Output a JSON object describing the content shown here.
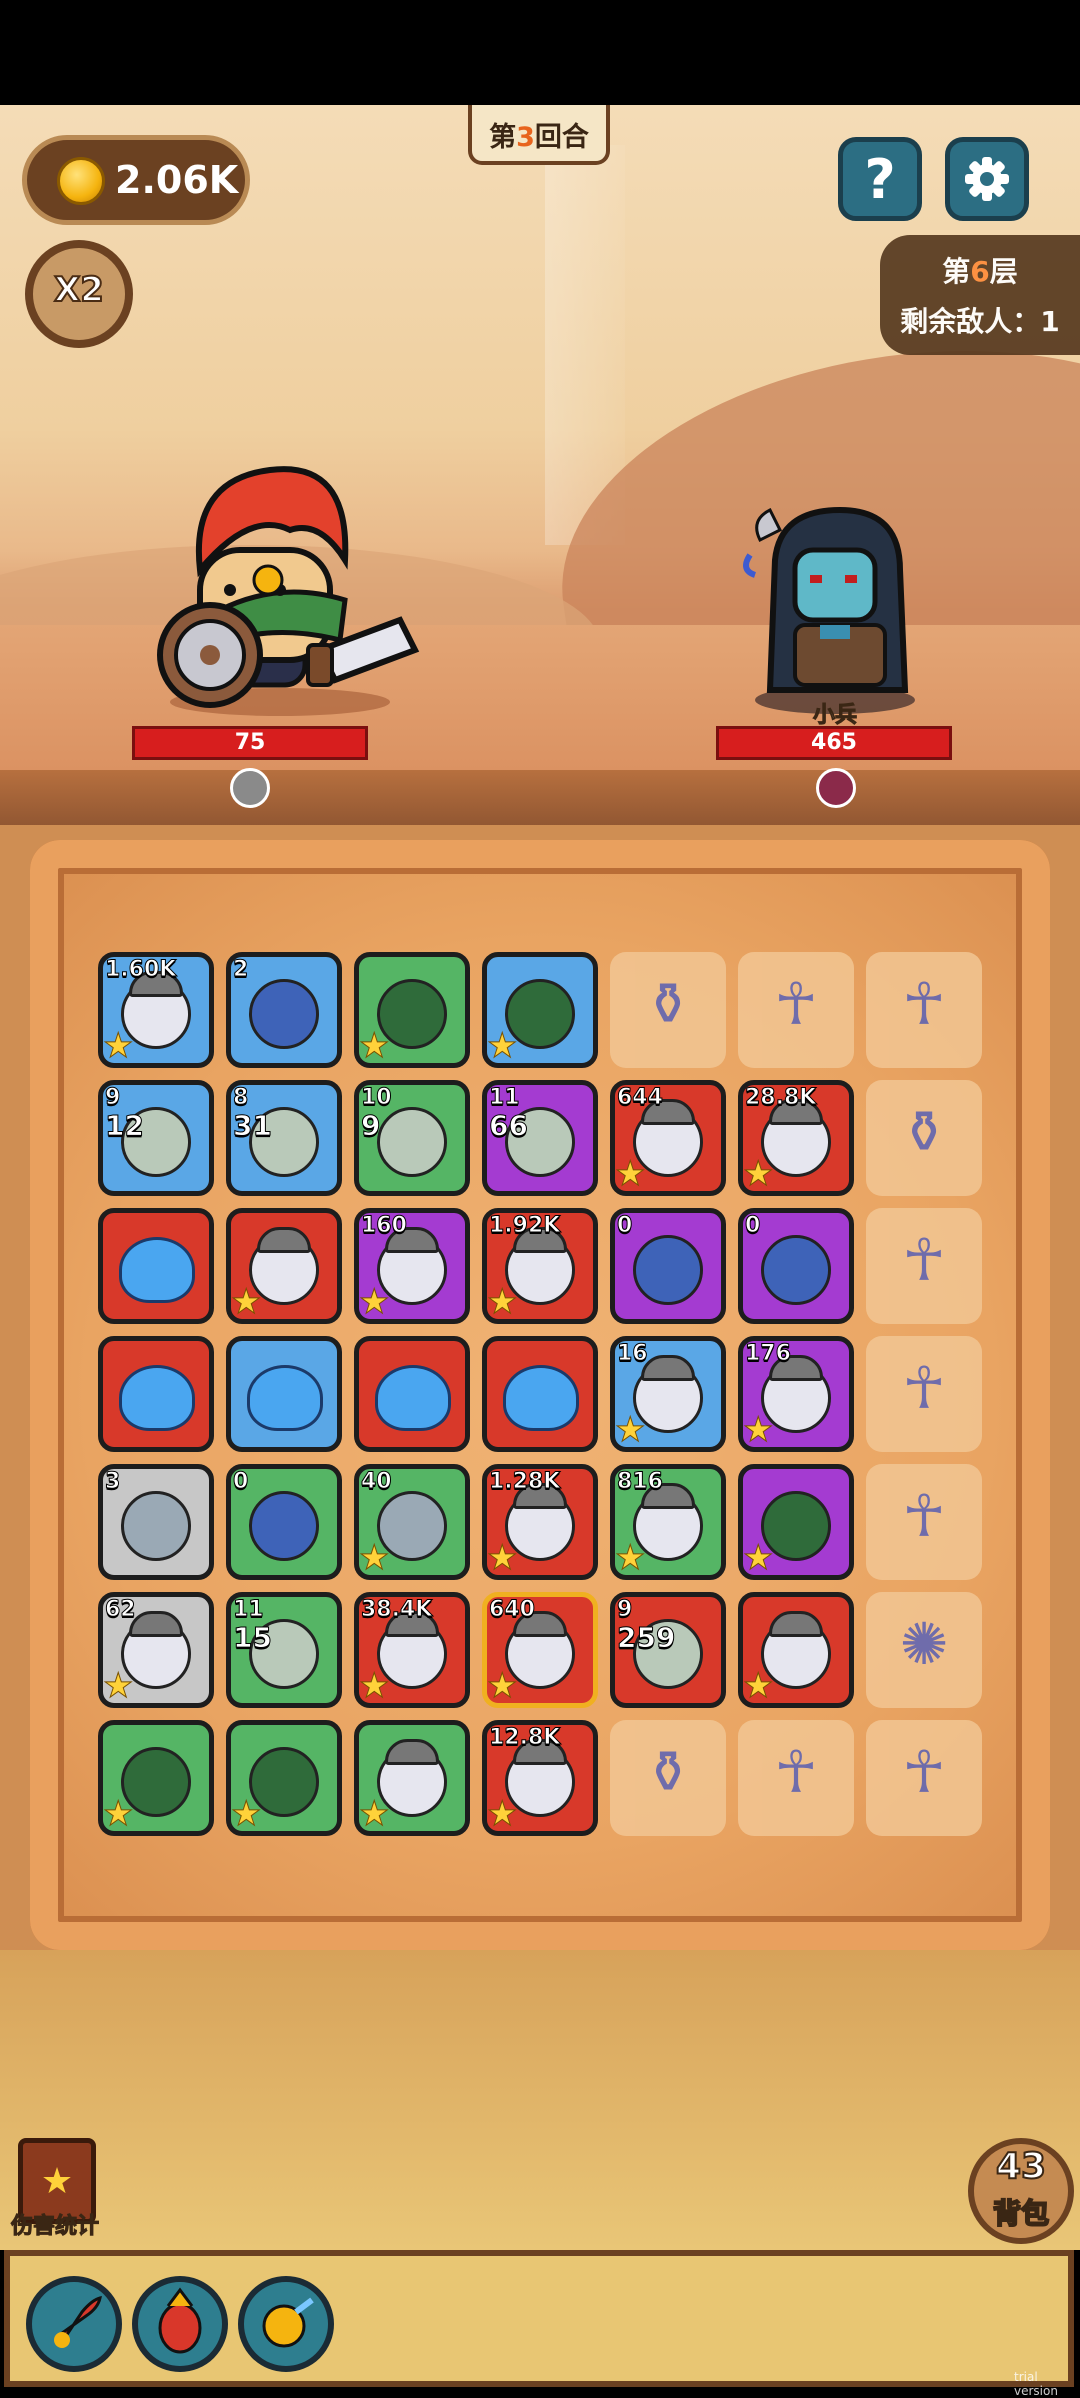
{
  "hud": {
    "coins": "2.06K",
    "speed_label": "X2",
    "round_prefix": "第",
    "round_num": "3",
    "round_suffix": "回合",
    "help_label": "?",
    "floor_prefix": "第",
    "floor_num": "6",
    "floor_suffix": "层",
    "enemies_left": "剩余敌人：1"
  },
  "battle": {
    "hero_hp": "75",
    "enemy_name": "小兵",
    "enemy_hp": "465"
  },
  "board": {
    "tiles": [
      {
        "color": "blue",
        "kind": "knight",
        "badge": "1.60K",
        "badge2": "",
        "star": true
      },
      {
        "color": "blue",
        "kind": "mage",
        "badge": "2",
        "badge2": "",
        "star": false
      },
      {
        "color": "green",
        "kind": "hood",
        "badge": "",
        "badge2": "",
        "star": true
      },
      {
        "color": "blue",
        "kind": "hood",
        "badge": "",
        "badge2": "",
        "star": true
      },
      {
        "color": "empty",
        "kind": "vase",
        "badge": "",
        "badge2": "",
        "star": false
      },
      {
        "color": "empty",
        "kind": "ankh",
        "badge": "",
        "badge2": "",
        "star": false
      },
      {
        "color": "empty",
        "kind": "ankh",
        "badge": "",
        "badge2": "",
        "star": false
      },
      {
        "color": "blue",
        "kind": "beast",
        "badge": "9",
        "badge2": "12",
        "star": false
      },
      {
        "color": "blue",
        "kind": "beast",
        "badge": "8",
        "badge2": "31",
        "star": false
      },
      {
        "color": "green",
        "kind": "beast",
        "badge": "10",
        "badge2": "9",
        "star": false
      },
      {
        "color": "purple",
        "kind": "beast",
        "badge": "11",
        "badge2": "66",
        "star": false
      },
      {
        "color": "red",
        "kind": "knight",
        "badge": "644",
        "badge2": "",
        "star": true
      },
      {
        "color": "red",
        "kind": "knight",
        "badge": "28.8K",
        "badge2": "",
        "star": true
      },
      {
        "color": "empty",
        "kind": "vase",
        "badge": "",
        "badge2": "",
        "star": false
      },
      {
        "color": "red",
        "kind": "slime",
        "badge": "",
        "badge2": "",
        "star": false
      },
      {
        "color": "red",
        "kind": "knight",
        "badge": "",
        "badge2": "",
        "star": true
      },
      {
        "color": "purple",
        "kind": "knight",
        "badge": "160",
        "badge2": "",
        "star": true
      },
      {
        "color": "red",
        "kind": "knight",
        "badge": "1.92K",
        "badge2": "",
        "star": true
      },
      {
        "color": "purple",
        "kind": "mage",
        "badge": "0",
        "badge2": "",
        "star": false
      },
      {
        "color": "purple",
        "kind": "mage",
        "badge": "0",
        "badge2": "",
        "star": false
      },
      {
        "color": "empty",
        "kind": "ankh",
        "badge": "",
        "badge2": "",
        "star": false
      },
      {
        "color": "red",
        "kind": "slime",
        "badge": "",
        "badge2": "",
        "star": false
      },
      {
        "color": "blue",
        "kind": "slime",
        "badge": "",
        "badge2": "",
        "star": false
      },
      {
        "color": "red",
        "kind": "slime",
        "badge": "",
        "badge2": "",
        "star": false
      },
      {
        "color": "red",
        "kind": "slime",
        "badge": "",
        "badge2": "",
        "star": false
      },
      {
        "color": "blue",
        "kind": "knight",
        "badge": "16",
        "badge2": "",
        "star": true
      },
      {
        "color": "purple",
        "kind": "knight",
        "badge": "176",
        "badge2": "",
        "star": true
      },
      {
        "color": "empty",
        "kind": "ankh",
        "badge": "",
        "badge2": "",
        "star": false
      },
      {
        "color": "gray",
        "kind": "robot",
        "badge": "3",
        "badge2": "",
        "star": false
      },
      {
        "color": "green",
        "kind": "mage",
        "badge": "0",
        "badge2": "",
        "star": false
      },
      {
        "color": "green",
        "kind": "robot",
        "badge": "40",
        "badge2": "",
        "star": true
      },
      {
        "color": "red",
        "kind": "knight",
        "badge": "1.28K",
        "badge2": "",
        "star": true
      },
      {
        "color": "green",
        "kind": "knight",
        "badge": "816",
        "badge2": "",
        "star": true
      },
      {
        "color": "purple",
        "kind": "hood",
        "badge": "",
        "badge2": "",
        "star": true
      },
      {
        "color": "empty",
        "kind": "ankh",
        "badge": "",
        "badge2": "",
        "star": false
      },
      {
        "color": "gray",
        "kind": "knight",
        "badge": "62",
        "badge2": "",
        "star": true
      },
      {
        "color": "green",
        "kind": "beast",
        "badge": "11",
        "badge2": "15",
        "star": false
      },
      {
        "color": "red",
        "kind": "knight",
        "badge": "38.4K",
        "badge2": "",
        "star": true
      },
      {
        "color": "red gold",
        "kind": "knight",
        "badge": "640",
        "badge2": "",
        "star": true
      },
      {
        "color": "red",
        "kind": "beast",
        "badge": "9",
        "badge2": "259",
        "star": false
      },
      {
        "color": "red",
        "kind": "knight",
        "badge": "",
        "badge2": "",
        "star": true
      },
      {
        "color": "empty",
        "kind": "sun",
        "badge": "",
        "badge2": "",
        "star": false
      },
      {
        "color": "green",
        "kind": "hood",
        "badge": "",
        "badge2": "",
        "star": true
      },
      {
        "color": "green",
        "kind": "hood",
        "badge": "",
        "badge2": "",
        "star": true
      },
      {
        "color": "green",
        "kind": "knight",
        "badge": "",
        "badge2": "",
        "star": true
      },
      {
        "color": "red",
        "kind": "knight",
        "badge": "12.8K",
        "badge2": "",
        "star": true
      },
      {
        "color": "empty",
        "kind": "vase",
        "badge": "",
        "badge2": "",
        "star": false
      },
      {
        "color": "empty",
        "kind": "ankh",
        "badge": "",
        "badge2": "",
        "star": false
      },
      {
        "color": "empty",
        "kind": "ankh",
        "badge": "",
        "badge2": "",
        "star": false
      }
    ]
  },
  "bottom": {
    "stats_label": "伤害统计",
    "bag_count": "43",
    "bag_label": "背包",
    "watermark": "trial version"
  },
  "glyphs": {
    "ankh": "☥",
    "vase": "⚱",
    "sun": "✺",
    "star": "★"
  }
}
